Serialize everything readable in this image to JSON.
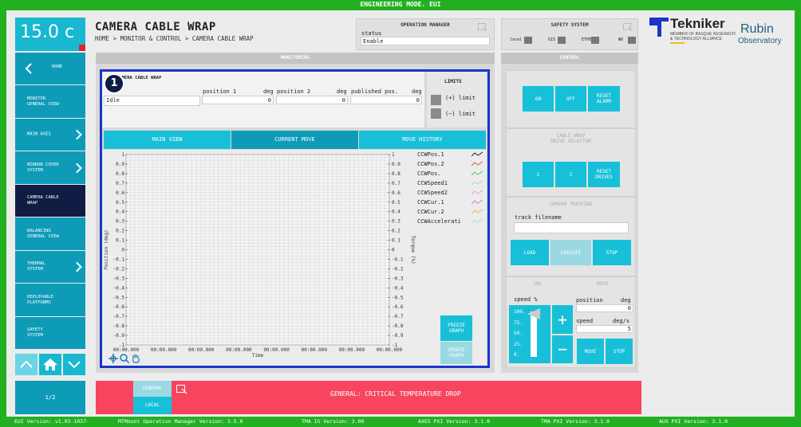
{
  "window": {
    "title": "ENGINEERING MODE. EUI"
  },
  "temperature": "15.0 c",
  "nav": {
    "home": "HOME",
    "items": [
      {
        "label": "MONITOR\nGENERAL VIEW",
        "chevron": false
      },
      {
        "label": "MAIN AXES",
        "chevron": true
      },
      {
        "label": "MIRROR COVER\nSYSTEM",
        "chevron": true
      },
      {
        "label": "CAMERA CABLE\nWRAP",
        "chevron": false,
        "active": true
      },
      {
        "label": "BALANCING\nGENERAL VIEW",
        "chevron": false
      },
      {
        "label": "THERMAL\nSYSTEM",
        "chevron": true
      },
      {
        "label": "DEPLOYABLE\nPLATFORMS",
        "chevron": false
      },
      {
        "label": "SAFETY\nSYSTEM",
        "chevron": false
      }
    ],
    "pager": "1/2"
  },
  "page": {
    "title": "CAMERA CABLE WRAP",
    "breadcrumb": "HOME > MONITOR & CONTROL > CAMERA CABLE WRAP"
  },
  "operation_manager": {
    "title": "OPERATION MANAGER",
    "status_label": "status",
    "status_value": "Enable"
  },
  "safety_system": {
    "title": "SAFETY SYSTEM",
    "leds": [
      "local",
      "GIS",
      "ETPB",
      "WD"
    ]
  },
  "logos": {
    "tekniker": "Tekniker",
    "tekniker_sub1": "MEMBER OF BASQUE RESEARCH",
    "tekniker_sub2": "& TECHNOLOGY ALLIANCE",
    "rubin": "Rubin",
    "rubin_sub": "Observatory"
  },
  "monitoring": {
    "header": "MONITORING",
    "badge": "1",
    "section_title": "CAMERA CABLE WRAP",
    "state_value": "Idle",
    "position1_label": "position 1",
    "position1_unit": "deg",
    "position1_value": "0",
    "position2_label": "position 2",
    "position2_unit": "deg",
    "position2_value": "0",
    "published_label": "published pos.",
    "published_unit": "deg",
    "published_value": "0",
    "limits_title": "LIMITS",
    "limit_pos": "(+) limit",
    "limit_neg": "(−) limit",
    "tabs": [
      "MAIN VIEW",
      "CURRENT MOVE",
      "MOVE HISTORY"
    ],
    "freeze_btn": "FREEZE\nGRAPH",
    "update_btn": "UPDATE\nGRAPH"
  },
  "control": {
    "header": "CONTROL",
    "on": "ON",
    "off": "OFF",
    "reset_alarm": "RESET\nALARM",
    "drive_selector": "CABLE WRAP\nDRIVE SELECTOR",
    "drive1": "1",
    "drive2": "2",
    "reset_drives": "RESET\nDRIVES",
    "camera_tracking": "CAMERA TRACKING",
    "track_filename_label": "track filename",
    "track_filename_value": "",
    "load": "LOAD",
    "execute": "EXECUTE",
    "stop": "STOP",
    "jog": "JOG",
    "move": "MOVE",
    "speed_pct_label": "speed %",
    "slider_ticks": [
      "100.",
      "75.",
      "50.",
      "25.",
      "0."
    ],
    "position_label": "position",
    "position_unit": "deg",
    "position_value": "0",
    "speed_label": "speed",
    "speed_unit": "deg/s",
    "speed_value": "5",
    "move_btn": "MOVE",
    "stop_btn": "STOP",
    "plus": "+",
    "minus": "−"
  },
  "alarm": {
    "general_tab": "GENERAL",
    "local_tab": "LOCAL",
    "message": "GENERAL: CRITICAL TEMPERATURE DROP"
  },
  "footer": [
    "EUI Version: v1.03-1037-",
    "MTMount Operation Manager Version: 3.5.0",
    "TMA IS Version: 3.00",
    "AXES PXI Version: 3.1.0",
    "TMA PXI Version: 3.1.0",
    "AUX PXI Version: 3.1.0"
  ],
  "chart_data": {
    "type": "line",
    "title": "",
    "xlabel": "Time",
    "ylabel": "Position (deg)",
    "y2label": "Torque (%)",
    "ylim": [
      -1,
      1
    ],
    "y2lim": [
      -1,
      1
    ],
    "y_ticks": [
      "1",
      "0.9",
      "0.8",
      "0.7",
      "0.6",
      "0.5",
      "0.4",
      "0.3",
      "0.2",
      "0.1",
      "0",
      "-0.1",
      "-0.2",
      "-0.3",
      "-0.4",
      "-0.5",
      "-0.6",
      "-0.7",
      "-0.8",
      "-0.9",
      "-1"
    ],
    "x_ticks": [
      "00:00.000",
      "00:00.000",
      "00:00.000",
      "00:00.000",
      "00:00.000",
      "00:00.000",
      "00:00.000",
      "00:00.000"
    ],
    "grid": true,
    "legend_position": "right",
    "series": [
      {
        "name": "CCWPos.1",
        "color": "#222222",
        "values": []
      },
      {
        "name": "CCWPos.2",
        "color": "#e05050",
        "values": []
      },
      {
        "name": "CCWPos.",
        "color": "#50d050",
        "values": []
      },
      {
        "name": "CCWSpeed1",
        "color": "#9ad8e2",
        "values": []
      },
      {
        "name": "CCWSpeed2",
        "color": "#e8a0c0",
        "values": []
      },
      {
        "name": "CCWCur.1",
        "color": "#c080e0",
        "values": []
      },
      {
        "name": "CCWCur.2",
        "color": "#e0c040",
        "values": []
      },
      {
        "name": "CCWAccelerati",
        "color": "#b0d8e8",
        "values": []
      }
    ]
  }
}
